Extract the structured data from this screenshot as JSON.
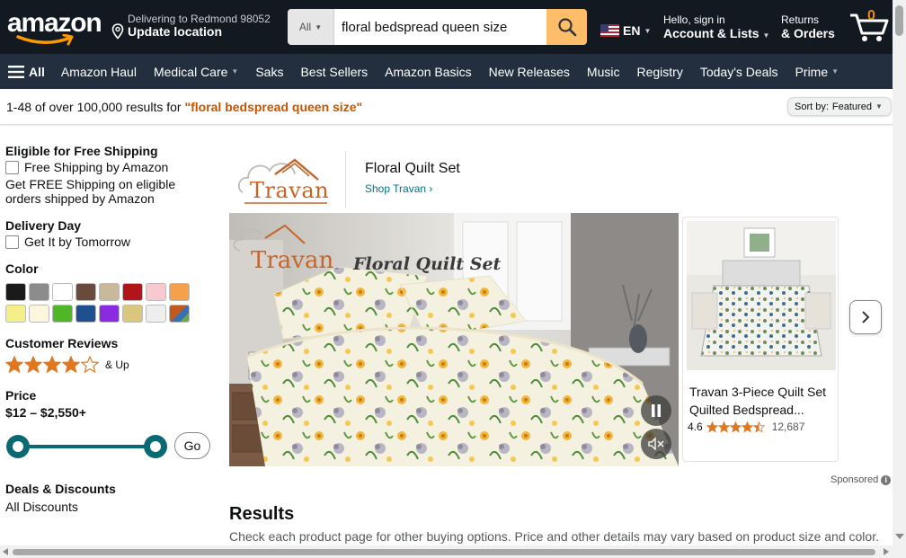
{
  "header": {
    "logo_text": "amazon",
    "delivery_line1": "Delivering to Redmond 98052",
    "delivery_line2": "Update location",
    "search_dept": "All",
    "search_value": "floral bedspread queen size",
    "lang": "EN",
    "account_line1": "Hello, sign in",
    "account_line2": "Account & Lists",
    "returns_line1": "Returns",
    "returns_line2": "& Orders",
    "cart_count": "0"
  },
  "nav": {
    "all_label": "All",
    "items": [
      "Amazon Haul",
      "Medical Care",
      "Saks",
      "Best Sellers",
      "Amazon Basics",
      "New Releases",
      "Music",
      "Registry",
      "Today's Deals",
      "Prime"
    ]
  },
  "results_bar": {
    "prefix": "1-48 of over 100,000 results for ",
    "query": "\"floral bedspread queen size\"",
    "sort_label": "Sort by:",
    "sort_value": "Featured"
  },
  "sidebar": {
    "free_shipping": {
      "heading": "Eligible for Free Shipping",
      "checkbox_label": "Free Shipping by Amazon",
      "note": "Get FREE Shipping on eligible orders shipped by Amazon"
    },
    "delivery": {
      "heading": "Delivery Day",
      "checkbox_label": "Get It by Tomorrow"
    },
    "color": {
      "heading": "Color",
      "swatches": [
        "#1a1a1a",
        "#8c8c8c",
        "#ffffff",
        "#6b4a3e",
        "#c9b99a",
        "#b0151a",
        "#f9c9d1",
        "#f5a04a",
        "#f5ef8a",
        "#fbf6dc",
        "#4fb626",
        "#1f4f8f",
        "#8a2be2",
        "#d8c77c",
        "#eeeeee",
        "multi"
      ]
    },
    "reviews": {
      "heading": "Customer Reviews",
      "stars": 4,
      "suffix": "& Up"
    },
    "price": {
      "heading": "Price",
      "range": "$12 – $2,550+",
      "go_label": "Go"
    },
    "deals": {
      "heading": "Deals & Discounts",
      "item": "All Discounts"
    }
  },
  "sponsored_brand": {
    "logo_text": "Travan",
    "brand_title": "Floral Quilt Set",
    "shop_link": "Shop Travan",
    "video_overlay_text": "Floral Quilt Set",
    "video_logo_text": "Travan",
    "product": {
      "title": "Travan 3-Piece Quilt Set Quilted Bedspread...",
      "rating": "4.6",
      "stars": 4.5,
      "review_count": "12,687"
    },
    "sponsored_label": "Sponsored",
    "star_color": "#de7921",
    "teal": "#0a6a74"
  },
  "results": {
    "heading": "Results",
    "subtext": "Check each product page for other buying options. Price and other details may vary based on product size and color."
  }
}
